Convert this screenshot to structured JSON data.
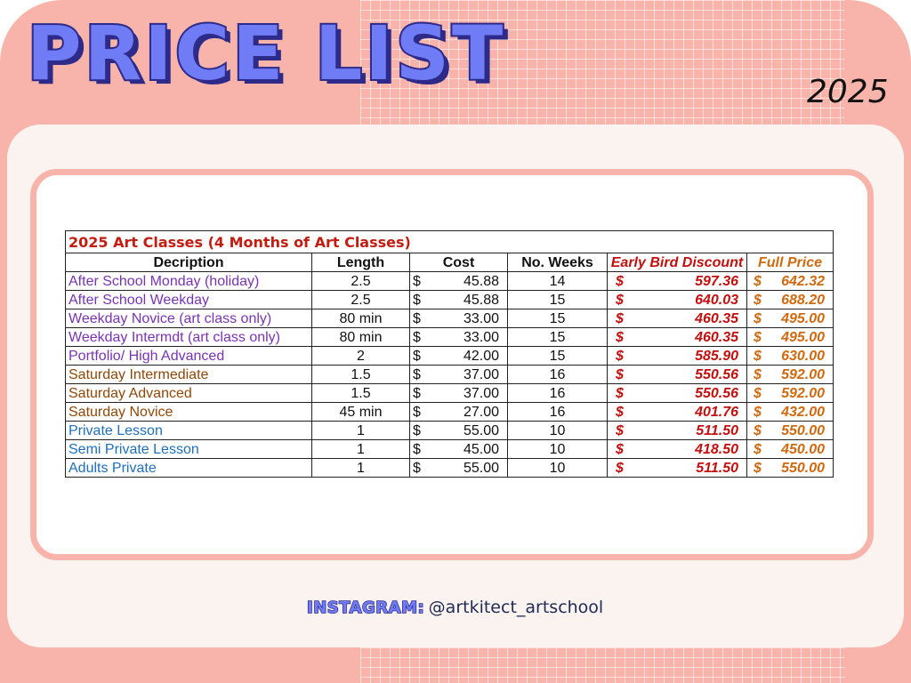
{
  "header": {
    "title": "PRICE LIST",
    "year": "2025"
  },
  "table": {
    "caption": "2025 Art Classes (4 Months of Art Classes)",
    "columns": [
      "Decription",
      "Length",
      "Cost",
      "No. Weeks",
      "Early Bird Discount",
      "Full Price"
    ],
    "currency": "$",
    "rows": [
      {
        "description": "After School Monday (holiday)",
        "length": "2.5",
        "cost": "45.88",
        "weeks": "14",
        "early_bird": "597.36",
        "full_price": "642.32",
        "group_color": "#7a33b3"
      },
      {
        "description": "After School Weekday",
        "length": "2.5",
        "cost": "45.88",
        "weeks": "15",
        "early_bird": "640.03",
        "full_price": "688.20",
        "group_color": "#7a33b3"
      },
      {
        "description": "Weekday Novice (art class only)",
        "length": "80 min",
        "cost": "33.00",
        "weeks": "15",
        "early_bird": "460.35",
        "full_price": "495.00",
        "group_color": "#7a33b3"
      },
      {
        "description": "Weekday Intermdt (art class only)",
        "length": "80 min",
        "cost": "33.00",
        "weeks": "15",
        "early_bird": "460.35",
        "full_price": "495.00",
        "group_color": "#7a33b3"
      },
      {
        "description": "Portfolio/ High Advanced",
        "length": "2",
        "cost": "42.00",
        "weeks": "15",
        "early_bird": "585.90",
        "full_price": "630.00",
        "group_color": "#7a33b3"
      },
      {
        "description": "Saturday Intermediate",
        "length": "1.5",
        "cost": "37.00",
        "weeks": "16",
        "early_bird": "550.56",
        "full_price": "592.00",
        "group_color": "#8f4708"
      },
      {
        "description": "Saturday Advanced",
        "length": "1.5",
        "cost": "37.00",
        "weeks": "16",
        "early_bird": "550.56",
        "full_price": "592.00",
        "group_color": "#8f4708"
      },
      {
        "description": "Saturday Novice",
        "length": "45 min",
        "cost": "27.00",
        "weeks": "16",
        "early_bird": "401.76",
        "full_price": "432.00",
        "group_color": "#8f4708"
      },
      {
        "description": "Private Lesson",
        "length": "1",
        "cost": "55.00",
        "weeks": "10",
        "early_bird": "511.50",
        "full_price": "550.00",
        "group_color": "#1e6fbd"
      },
      {
        "description": "Semi Private Lesson",
        "length": "1",
        "cost": "45.00",
        "weeks": "10",
        "early_bird": "418.50",
        "full_price": "450.00",
        "group_color": "#1e6fbd"
      },
      {
        "description": "Adults Private",
        "length": "1",
        "cost": "55.00",
        "weeks": "10",
        "early_bird": "511.50",
        "full_price": "550.00",
        "group_color": "#1e6fbd"
      }
    ]
  },
  "footer": {
    "instagram_label": "INSTAGRAM:",
    "instagram_handle": "@artkitect_artschool"
  },
  "colors": {
    "background_pink": "#f8b3aa",
    "panel_cream": "#fbf3ef",
    "title_blue": "#6f7cf5",
    "title_outline": "#2d2a8a",
    "caption_red": "#c21d10",
    "early_bird_red": "#c40f0f",
    "full_price_orange": "#d06a10"
  }
}
